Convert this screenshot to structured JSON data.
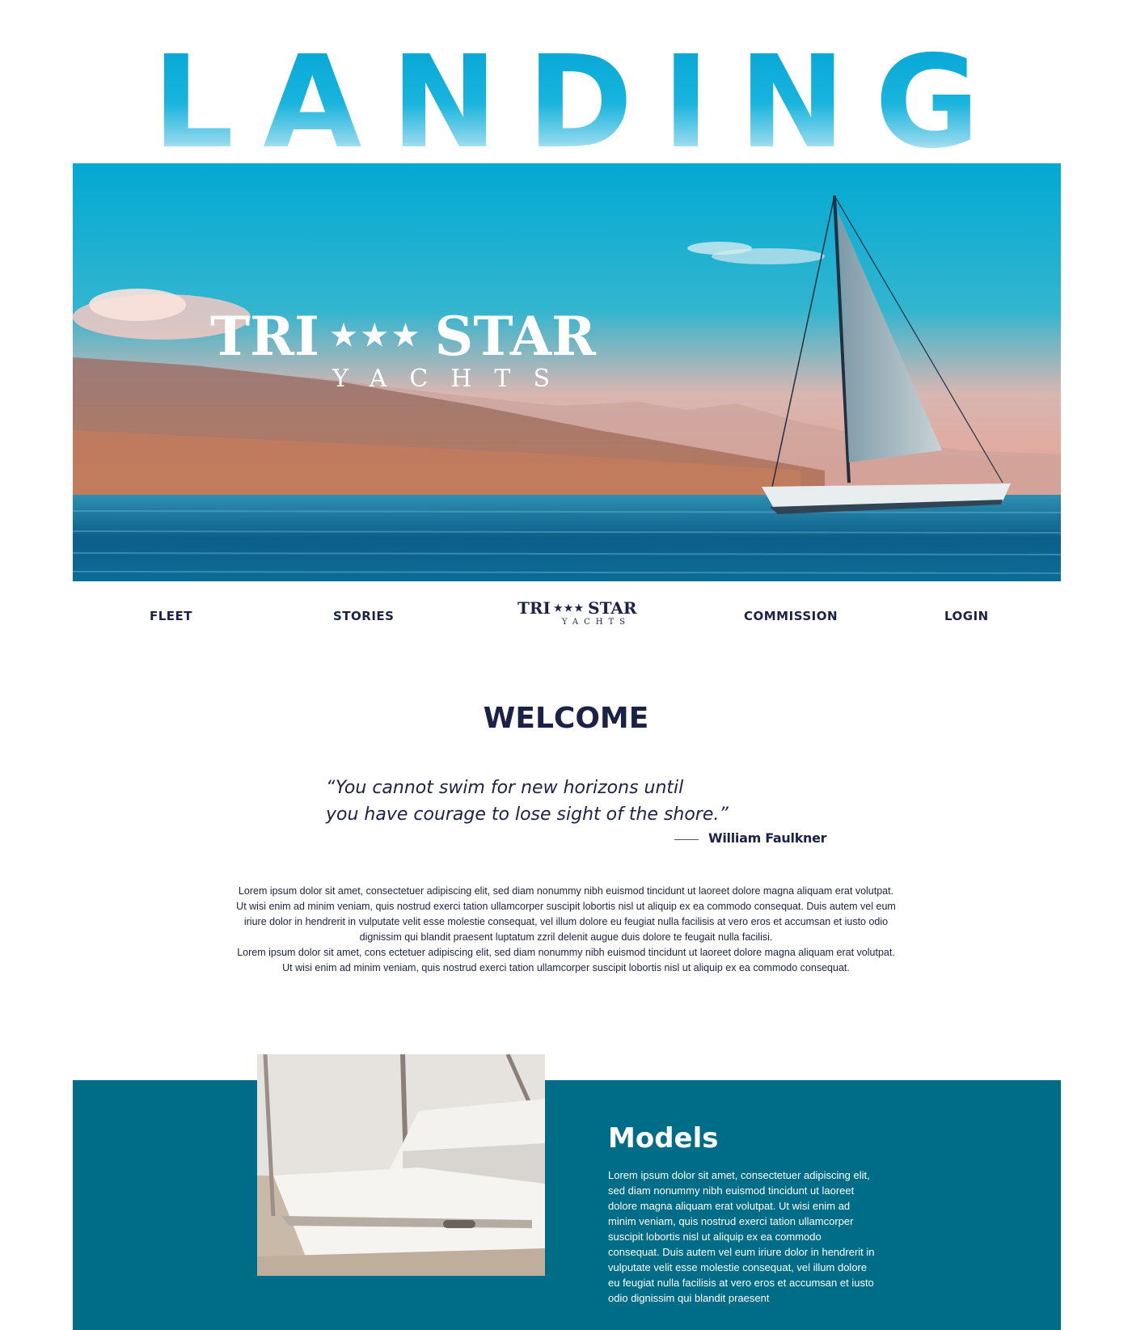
{
  "hero": {
    "headline": "LANDING",
    "brand_left": "TRI",
    "brand_stars": "★★★",
    "brand_right": "STAR",
    "brand_sub": "YACHTS"
  },
  "nav": {
    "items": [
      {
        "label": "FLEET"
      },
      {
        "label": "STORIES"
      },
      {
        "label": "COMMISSION"
      },
      {
        "label": "LOGIN"
      }
    ],
    "logo_left": "TRI",
    "logo_stars": "★★★",
    "logo_right": "STAR",
    "logo_sub": "YACHTS"
  },
  "welcome": {
    "title": "WELCOME",
    "quote_line1": "“You cannot swim for new horizons until",
    "quote_line2": "you have courage to lose sight of the shore.”",
    "quote_author": "William Faulkner",
    "body": "Lorem ipsum dolor sit amet, consectetuer adipiscing elit, sed diam nonummy nibh euismod tincidunt ut laoreet dolore magna aliquam erat volutpat. Ut wisi enim ad minim veniam, quis nostrud exerci tation ullamcorper suscipit lobortis nisl ut aliquip ex ea commodo consequat. Duis autem vel eum iriure dolor in hendrerit in vulputate velit esse molestie consequat, vel illum dolore eu feugiat nulla facilisis at vero eros et accumsan et iusto odio dignissim qui blandit praesent luptatum zzril delenit augue duis dolore te feugait nulla facilisi.",
    "body2": "Lorem ipsum dolor sit amet, cons ectetuer adipiscing elit, sed diam nonummy nibh euismod tincidunt ut laoreet dolore magna aliquam erat volutpat. Ut wisi enim ad minim veniam, quis nostrud exerci tation ullamcorper suscipit lobortis nisl ut aliquip ex ea commodo consequat."
  },
  "models": {
    "title": "Models",
    "body": "Lorem ipsum dolor sit amet, consectetuer adipiscing elit, sed diam nonummy nibh euismod tincidunt ut laoreet dolore magna aliquam erat volutpat. Ut wisi enim ad minim veniam, quis nostrud exerci tation ullamcorper suscipit lobortis nisl ut aliquip ex ea commodo consequat. Duis autem vel eum iriure dolor in hendrerit in vulputate velit esse molestie consequat, vel illum dolore eu feugiat nulla facilisis at vero eros et accumsan et iusto odio dignissim qui blandit praesent"
  },
  "colors": {
    "accent": "#0aa8d6",
    "navy": "#1b2147",
    "teal_band": "#006d88"
  }
}
